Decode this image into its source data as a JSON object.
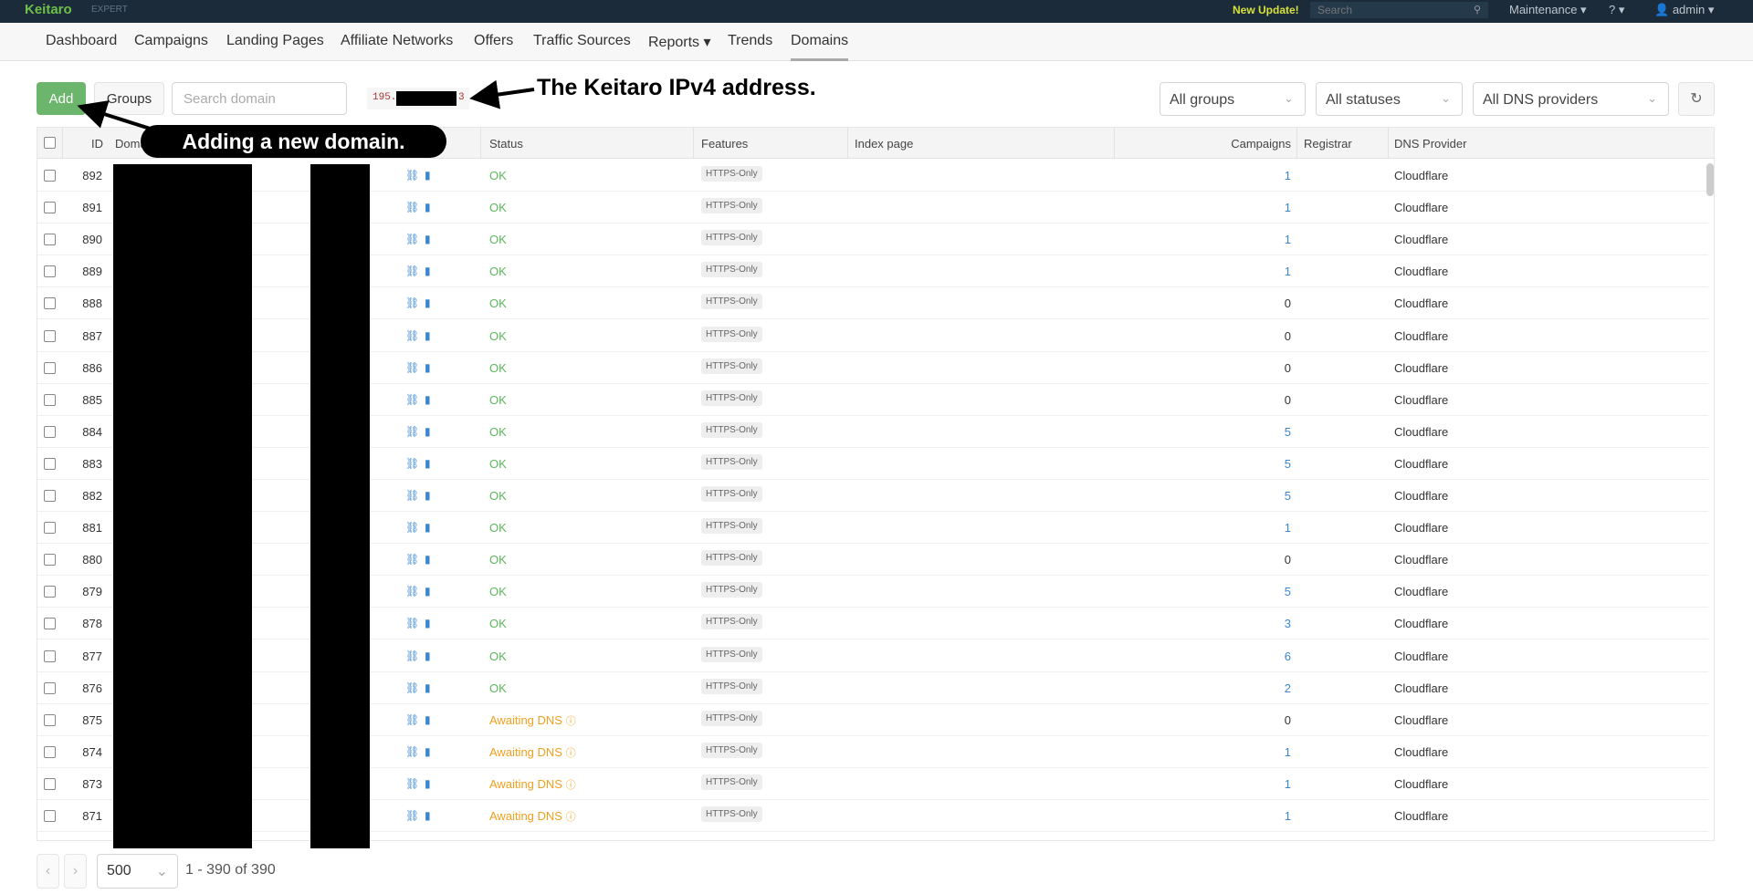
{
  "topbar": {
    "logo": "Keitaro",
    "edition": "EXPERT",
    "new_update": "New Update!",
    "search_placeholder": "Search",
    "maintenance": "Maintenance ▾",
    "help": "? ▾",
    "user": "admin ▾"
  },
  "nav": [
    "Dashboard",
    "Campaigns",
    "Landing Pages",
    "Affiliate Networks",
    "Offers",
    "Traffic Sources",
    "Reports ▾",
    "Trends",
    "Domains"
  ],
  "toolbar": {
    "add": "Add",
    "groups": "Groups",
    "search_placeholder": "Search domain",
    "ip_prefix": "195.",
    "ip_suffix": "3",
    "filter_groups": "All groups",
    "filter_statuses": "All statuses",
    "filter_dns": "All DNS providers"
  },
  "annotations": {
    "ip": "The Keitaro IPv4 address.",
    "add": "Adding a new domain."
  },
  "columns": {
    "id": "ID",
    "domain": "Doma",
    "status": "Status",
    "features": "Features",
    "index_page": "Index page",
    "campaigns": "Campaigns",
    "registrar": "Registrar",
    "dns": "DNS Provider"
  },
  "colors": {
    "ok": "#5cb85c",
    "awaiting": "#f0a020",
    "link": "#3a87d0",
    "add": "#6cb56c"
  },
  "rows": [
    {
      "id": "892",
      "status": "OK",
      "feature": "HTTPS-Only",
      "campaigns": "1",
      "dns": "Cloudflare"
    },
    {
      "id": "891",
      "status": "OK",
      "feature": "HTTPS-Only",
      "campaigns": "1",
      "dns": "Cloudflare"
    },
    {
      "id": "890",
      "status": "OK",
      "feature": "HTTPS-Only",
      "campaigns": "1",
      "dns": "Cloudflare"
    },
    {
      "id": "889",
      "status": "OK",
      "feature": "HTTPS-Only",
      "campaigns": "1",
      "dns": "Cloudflare"
    },
    {
      "id": "888",
      "status": "OK",
      "feature": "HTTPS-Only",
      "campaigns": "0",
      "dns": "Cloudflare"
    },
    {
      "id": "887",
      "status": "OK",
      "feature": "HTTPS-Only",
      "campaigns": "0",
      "dns": "Cloudflare"
    },
    {
      "id": "886",
      "status": "OK",
      "feature": "HTTPS-Only",
      "campaigns": "0",
      "dns": "Cloudflare"
    },
    {
      "id": "885",
      "status": "OK",
      "feature": "HTTPS-Only",
      "campaigns": "0",
      "dns": "Cloudflare"
    },
    {
      "id": "884",
      "status": "OK",
      "feature": "HTTPS-Only",
      "campaigns": "5",
      "dns": "Cloudflare"
    },
    {
      "id": "883",
      "status": "OK",
      "feature": "HTTPS-Only",
      "campaigns": "5",
      "dns": "Cloudflare"
    },
    {
      "id": "882",
      "status": "OK",
      "feature": "HTTPS-Only",
      "campaigns": "5",
      "dns": "Cloudflare"
    },
    {
      "id": "881",
      "status": "OK",
      "feature": "HTTPS-Only",
      "campaigns": "1",
      "dns": "Cloudflare"
    },
    {
      "id": "880",
      "status": "OK",
      "feature": "HTTPS-Only",
      "campaigns": "0",
      "dns": "Cloudflare"
    },
    {
      "id": "879",
      "status": "OK",
      "feature": "HTTPS-Only",
      "campaigns": "5",
      "dns": "Cloudflare"
    },
    {
      "id": "878",
      "status": "OK",
      "feature": "HTTPS-Only",
      "campaigns": "3",
      "dns": "Cloudflare"
    },
    {
      "id": "877",
      "status": "OK",
      "feature": "HTTPS-Only",
      "campaigns": "6",
      "dns": "Cloudflare"
    },
    {
      "id": "876",
      "status": "OK",
      "feature": "HTTPS-Only",
      "campaigns": "2",
      "dns": "Cloudflare"
    },
    {
      "id": "875",
      "status": "Awaiting DNS",
      "feature": "HTTPS-Only",
      "campaigns": "0",
      "dns": "Cloudflare"
    },
    {
      "id": "874",
      "status": "Awaiting DNS",
      "feature": "HTTPS-Only",
      "campaigns": "1",
      "dns": "Cloudflare"
    },
    {
      "id": "873",
      "status": "Awaiting DNS",
      "feature": "HTTPS-Only",
      "campaigns": "1",
      "dns": "Cloudflare"
    },
    {
      "id": "871",
      "status": "Awaiting DNS",
      "feature": "HTTPS-Only",
      "campaigns": "1",
      "dns": "Cloudflare"
    }
  ],
  "pagination": {
    "per_page": "500",
    "info": "1 - 390 of 390"
  }
}
